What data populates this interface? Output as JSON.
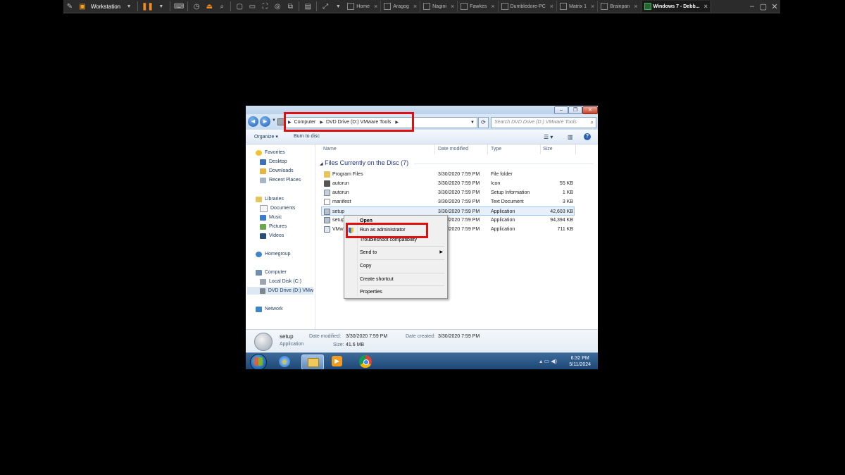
{
  "vmware": {
    "product_label": "Workstation",
    "tabs": [
      {
        "label": "Home"
      },
      {
        "label": "Aragog"
      },
      {
        "label": "Nagini"
      },
      {
        "label": "Fawkes"
      },
      {
        "label": "Dumbledore-PC"
      },
      {
        "label": "Matrix 1"
      },
      {
        "label": "Brainpan"
      },
      {
        "label": "Windows 7 - Debb..."
      }
    ]
  },
  "explorer": {
    "breadcrumb": [
      "Computer",
      "DVD Drive (D:) VMware Tools"
    ],
    "search_placeholder": "Search DVD Drive (D:) VMware Tools",
    "commands": {
      "organize": "Organize",
      "burn": "Burn to disc"
    },
    "nav": {
      "favorites": {
        "label": "Favorites",
        "items": [
          "Desktop",
          "Downloads",
          "Recent Places"
        ]
      },
      "libraries": {
        "label": "Libraries",
        "items": [
          "Documents",
          "Music",
          "Pictures",
          "Videos"
        ]
      },
      "homegroup": "Homegroup",
      "computer": {
        "label": "Computer",
        "items": [
          "Local Disk (C:)",
          "DVD Drive (D:) VMw"
        ]
      },
      "network": "Network"
    },
    "columns": {
      "name": "Name",
      "date": "Date modified",
      "type": "Type",
      "size": "Size"
    },
    "group_label": "Files Currently on the Disc (7)",
    "files": [
      {
        "name": "Program Files",
        "date": "3/30/2020 7:59 PM",
        "type": "File folder",
        "size": ""
      },
      {
        "name": "autorun",
        "date": "3/30/2020 7:59 PM",
        "type": "Icon",
        "size": "55 KB"
      },
      {
        "name": "autorun",
        "date": "3/30/2020 7:59 PM",
        "type": "Setup Information",
        "size": "1 KB"
      },
      {
        "name": "manifest",
        "date": "3/30/2020 7:59 PM",
        "type": "Text Document",
        "size": "3 KB"
      },
      {
        "name": "setup",
        "date": "3/30/2020 7:59 PM",
        "type": "Application",
        "size": "42,603 KB"
      },
      {
        "name": "setup",
        "date": "3/30/2020 7:59 PM",
        "type": "Application",
        "size": "94,394 KB"
      },
      {
        "name": "VMw",
        "date": "3/30/2020 7:59 PM",
        "type": "Application",
        "size": "711 KB"
      }
    ],
    "details": {
      "name": "setup",
      "kind": "Application",
      "modified_label": "Date modified:",
      "modified": "3/30/2020 7:59 PM",
      "created_label": "Date created:",
      "created": "3/30/2020 7:59 PM",
      "size_label": "Size:",
      "size": "41.6 MB"
    },
    "context_menu": {
      "open": "Open",
      "run_admin": "Run as administrator",
      "troubleshoot": "Troubleshoot compatibility",
      "send_to": "Send to",
      "copy": "Copy",
      "create_shortcut": "Create shortcut",
      "properties": "Properties"
    }
  },
  "taskbar": {
    "time": "6:32 PM",
    "date": "5/11/2024"
  },
  "colors": {
    "highlight": "#e01010",
    "taskbar": "#1c4775",
    "vm_toolbar": "#2b2b2b"
  }
}
